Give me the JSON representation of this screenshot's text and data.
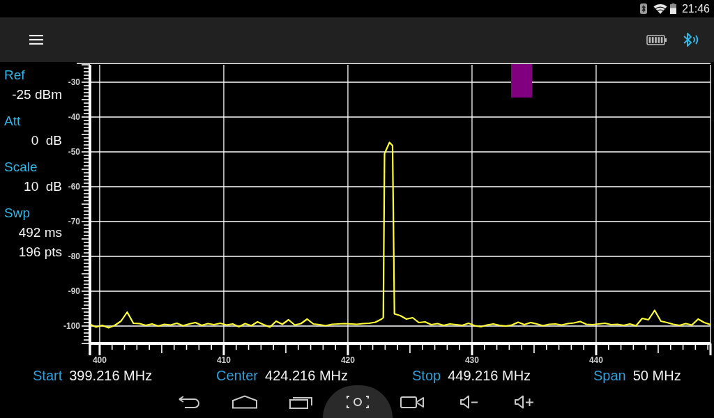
{
  "status_bar": {
    "time": "21:46"
  },
  "parameters": [
    {
      "label": "Ref",
      "values": [
        "-25 dBm"
      ]
    },
    {
      "label": "Att",
      "values": [
        "0  dB"
      ]
    },
    {
      "label": "Scale",
      "values": [
        "10  dB"
      ]
    },
    {
      "label": "Swp",
      "values": [
        "492 ms",
        "196 pts"
      ]
    }
  ],
  "spectrum": {
    "chart_data": {
      "type": "line",
      "grid": true,
      "xlim": [
        399.216,
        449.216
      ],
      "ylim": [
        -105,
        -25
      ],
      "xticks": [
        400,
        410,
        420,
        430,
        440
      ],
      "yticks": [
        -30,
        -40,
        -50,
        -60,
        -70,
        -80,
        -90,
        -100
      ],
      "x": [
        399.216,
        399.716,
        400.216,
        400.716,
        401.216,
        401.716,
        402.216,
        402.716,
        403.216,
        403.716,
        404.216,
        404.716,
        405.216,
        405.716,
        406.216,
        406.716,
        407.216,
        407.716,
        408.216,
        408.716,
        409.216,
        409.716,
        410.216,
        410.716,
        411.216,
        411.716,
        412.216,
        412.716,
        413.216,
        413.716,
        414.216,
        414.716,
        415.216,
        415.716,
        416.216,
        416.716,
        417.216,
        417.716,
        418.216,
        418.716,
        419.216,
        419.716,
        420.216,
        420.716,
        421.216,
        421.716,
        422.216,
        422.716,
        422.85,
        422.95,
        423.2,
        423.35,
        423.6,
        423.75,
        424.216,
        424.716,
        425.216,
        425.716,
        426.216,
        426.716,
        427.216,
        427.716,
        428.216,
        428.716,
        429.216,
        429.716,
        430.216,
        430.716,
        431.216,
        431.716,
        432.216,
        432.716,
        433.216,
        433.716,
        434.216,
        434.716,
        435.216,
        435.716,
        436.216,
        436.716,
        437.216,
        437.716,
        438.216,
        438.716,
        439.216,
        439.716,
        440.216,
        440.716,
        441.216,
        441.716,
        442.216,
        442.716,
        443.216,
        443.716,
        444.216,
        444.716,
        445.216,
        445.716,
        446.216,
        446.716,
        447.216,
        447.716,
        448.216,
        448.716,
        449.216
      ],
      "series": [
        {
          "color": "#ffff33",
          "values": [
            -99.5,
            -100.3,
            -99.8,
            -100.5,
            -99.8,
            -98.6,
            -96.0,
            -99.2,
            -99.3,
            -99.8,
            -99.4,
            -100,
            -99.5,
            -99.7,
            -99.2,
            -99.9,
            -99.4,
            -99.0,
            -99.8,
            -99.3,
            -99.6,
            -99.2,
            -99.7,
            -99.4,
            -100.2,
            -99.3,
            -99.9,
            -98.8,
            -99.6,
            -100.3,
            -98.6,
            -99.5,
            -98.2,
            -99.7,
            -99.3,
            -98.0,
            -99.4,
            -99.6,
            -99.9,
            -99.5,
            -99.4,
            -99.3,
            -99.4,
            -99.5,
            -99.3,
            -99.2,
            -98.9,
            -98.0,
            -97.6,
            -50.5,
            -48.5,
            -47.3,
            -48.2,
            -96.5,
            -97.0,
            -98.0,
            -97.6,
            -99.0,
            -98.8,
            -99.6,
            -99.3,
            -99.8,
            -99.4,
            -99.6,
            -99.8,
            -99.2,
            -99.9,
            -100.2,
            -99.7,
            -99.4,
            -99.8,
            -100,
            -99.7,
            -98.9,
            -99.6,
            -99.0,
            -99.4,
            -99.9,
            -99.5,
            -99.4,
            -99.7,
            -99.3,
            -99.1,
            -98.7,
            -99.5,
            -99.6,
            -99.4,
            -99.2,
            -99.6,
            -99.5,
            -99.8,
            -99.4,
            -99.9,
            -97.8,
            -98.2,
            -95.5,
            -98.6,
            -99.0,
            -99.5,
            -99.8,
            -99.3,
            -99.7,
            -98.0,
            -99.0,
            -99.6
          ]
        }
      ]
    }
  },
  "frequency_bar": [
    {
      "label": "Start",
      "value": "399.216 MHz"
    },
    {
      "label": "Center",
      "value": "424.216 MHz"
    },
    {
      "label": "Stop",
      "value": "449.216 MHz"
    },
    {
      "label": "Span",
      "value": "50 MHz"
    }
  ]
}
